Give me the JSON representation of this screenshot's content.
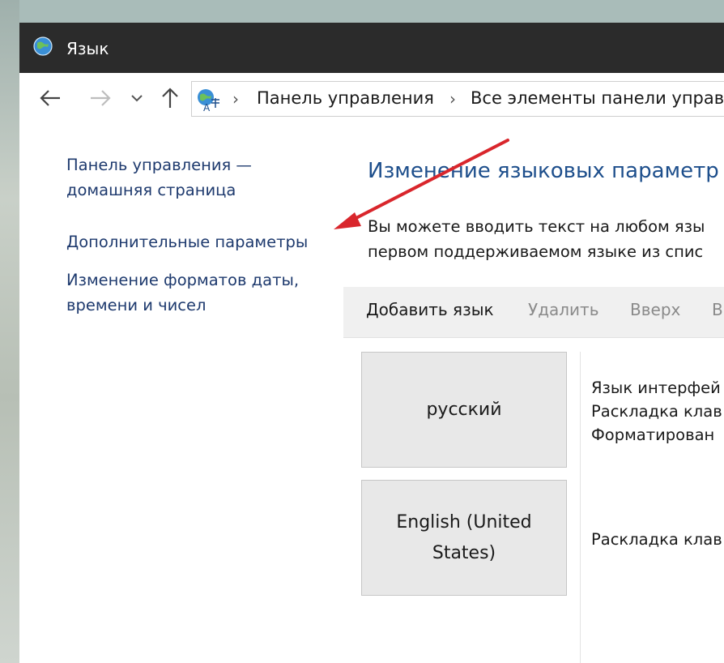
{
  "window": {
    "title": "Язык",
    "icon": "globe-language-icon"
  },
  "nav": {
    "back_icon": "arrow-left-icon",
    "forward_icon": "arrow-right-icon",
    "recent_icon": "chevron-down-icon",
    "up_icon": "arrow-up-icon"
  },
  "address": {
    "icon": "language-control-panel-icon",
    "separator": "›",
    "crumbs": [
      "Панель управления",
      "Все элементы панели управ"
    ]
  },
  "sidebar": {
    "home_line1": "Панель управления —",
    "home_line2": "домашняя страница",
    "advanced": "Дополнительные параметры",
    "formats_line1": "Изменение форматов даты,",
    "formats_line2": "времени и чисел"
  },
  "main": {
    "heading": "Изменение языковых параметр",
    "desc_line1": "Вы можете вводить текст на любом язы",
    "desc_line2": "первом поддерживаемом языке из спис"
  },
  "toolbar": {
    "add": "Добавить язык",
    "delete": "Удалить",
    "up": "Вверх",
    "down": "В"
  },
  "languages": [
    {
      "name": "русский",
      "details": [
        "Язык интерфей",
        "Раскладка клав",
        "Форматирован"
      ]
    },
    {
      "name": "English (United States)",
      "details": [
        "Раскладка клав"
      ]
    }
  ],
  "colors": {
    "titlebar": "#2b2b2b",
    "link": "#1e3a6e",
    "heading": "#1e4f8c",
    "annotation_arrow": "#d9262c"
  }
}
